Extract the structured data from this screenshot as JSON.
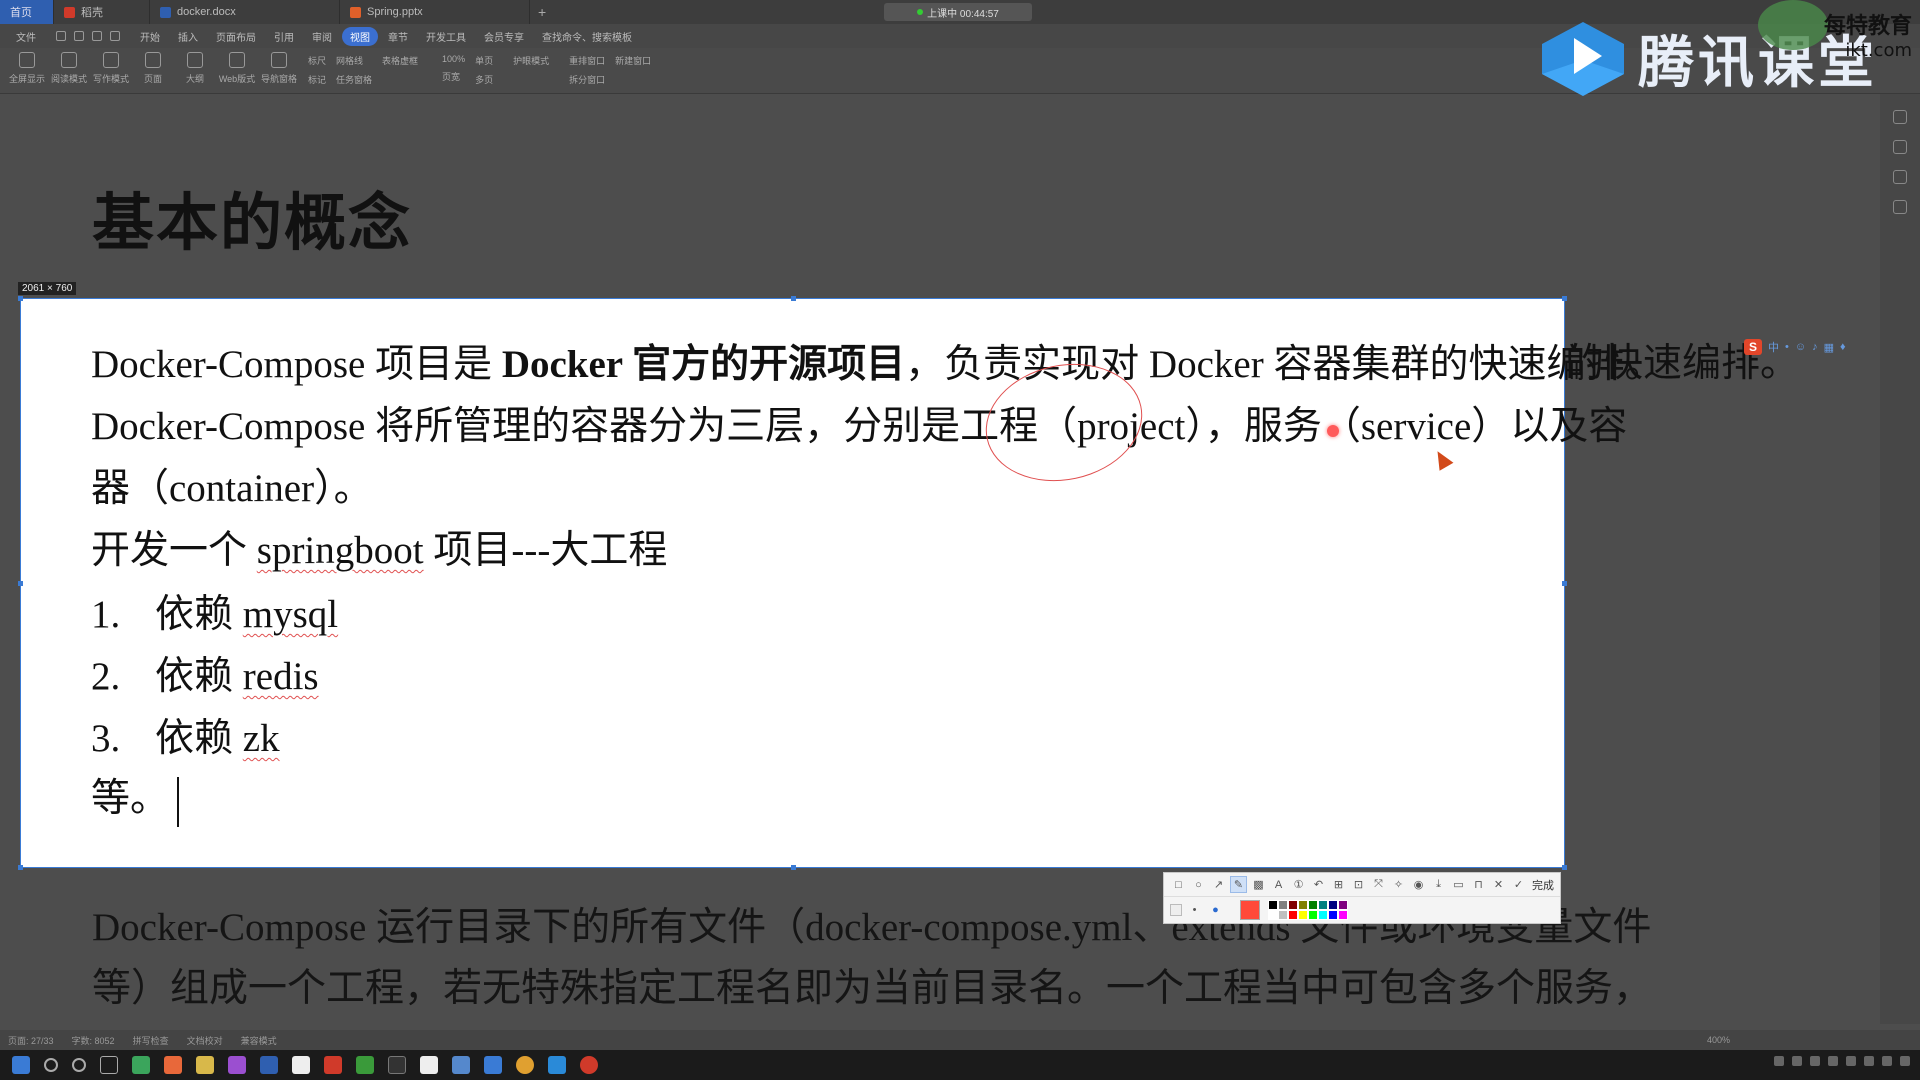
{
  "window": {
    "tabs": [
      {
        "label": "首页",
        "color": "#2f5fb0"
      },
      {
        "label": "稻壳",
        "color": "#d03a2a"
      },
      {
        "label": "docker.docx",
        "color": "#2f5fb0"
      },
      {
        "label": "Spring.pptx",
        "color": "#e0602a"
      }
    ],
    "new_tab": "+",
    "timer": "上课中 00:44:57"
  },
  "menu": {
    "items": [
      "文件",
      "开始",
      "插入",
      "页面布局",
      "引用",
      "审阅",
      "视图",
      "章节",
      "开发工具",
      "会员专享",
      "查找命令、搜索模板"
    ],
    "active_index": 6
  },
  "ribbon": {
    "buttons": [
      "全屏显示",
      "阅读模式",
      "写作模式",
      "页面",
      "大纲",
      "Web版式",
      "导航窗格"
    ],
    "small": [
      [
        "标尺",
        "网格线",
        "表格虚框"
      ],
      [
        "标记",
        "任务窗格"
      ],
      [
        "100%",
        "单页"
      ],
      [
        "页宽",
        "多页"
      ],
      [
        "护眼模式"
      ],
      [
        "重排窗口",
        "新建窗口"
      ],
      [
        "拆分窗口"
      ]
    ]
  },
  "logo": {
    "text": "腾讯课堂"
  },
  "corner": {
    "line1": "每特教育",
    "line2": "ikt.com"
  },
  "document": {
    "heading": "基本的概念",
    "bottom_lines": [
      "Docker-Compose 运行目录下的所有文件（docker-compose.yml、extends 文件或环境变量文件",
      "等）组成一个工程，若无特殊指定工程名即为当前目录名。一个工程当中可包含多个服务，"
    ]
  },
  "capture": {
    "size_badge": "2061 × 760",
    "line1_a": "Docker-Compose 项目是 ",
    "line1_b": "Docker 官方的开源项目",
    "line1_c": "，负责实现对 Docker 容器集群的快速编排。",
    "line2": "Docker-Compose 将所管理的容器分为三层，分别是工程（project），服务（service）以及容",
    "line3": "器（container）。",
    "line4_a": "开发一个 ",
    "line4_b": "springboot",
    "line4_c": " 项目---大工程",
    "list": [
      {
        "num": "1.",
        "text": "依赖 ",
        "word": "mysql"
      },
      {
        "num": "2.",
        "text": "依赖 ",
        "word": "redis"
      },
      {
        "num": "3.",
        "text": "依赖 ",
        "word": "zk"
      }
    ],
    "last_line": "等。",
    "overflow_right": "的快速编排。"
  },
  "capture_toolbar": {
    "tools": [
      "rect-icon",
      "ellipse-icon",
      "arrow-icon",
      "pen-icon",
      "mosaic-icon",
      "text-icon",
      "step-icon",
      "undo-icon",
      "pin-icon",
      "ocr-icon",
      "translate-icon",
      "pin2-icon",
      "record-icon",
      "download-icon",
      "save-icon",
      "bookmark-icon",
      "close-icon"
    ],
    "done_label": "完成",
    "current_color": "#ff4a3a",
    "swatches": [
      "#000000",
      "#808080",
      "#800000",
      "#808000",
      "#008000",
      "#008080",
      "#000080",
      "#800080",
      "#ffffff",
      "#c0c0c0",
      "#ff0000",
      "#ffff00",
      "#00ff00",
      "#00ffff",
      "#0000ff",
      "#ff00ff"
    ]
  },
  "statusbar": {
    "items": [
      "页面: 27/33",
      "字数: 8052",
      "拼写检查",
      "文档校对",
      "兼容模式"
    ],
    "zoom": "400%"
  }
}
